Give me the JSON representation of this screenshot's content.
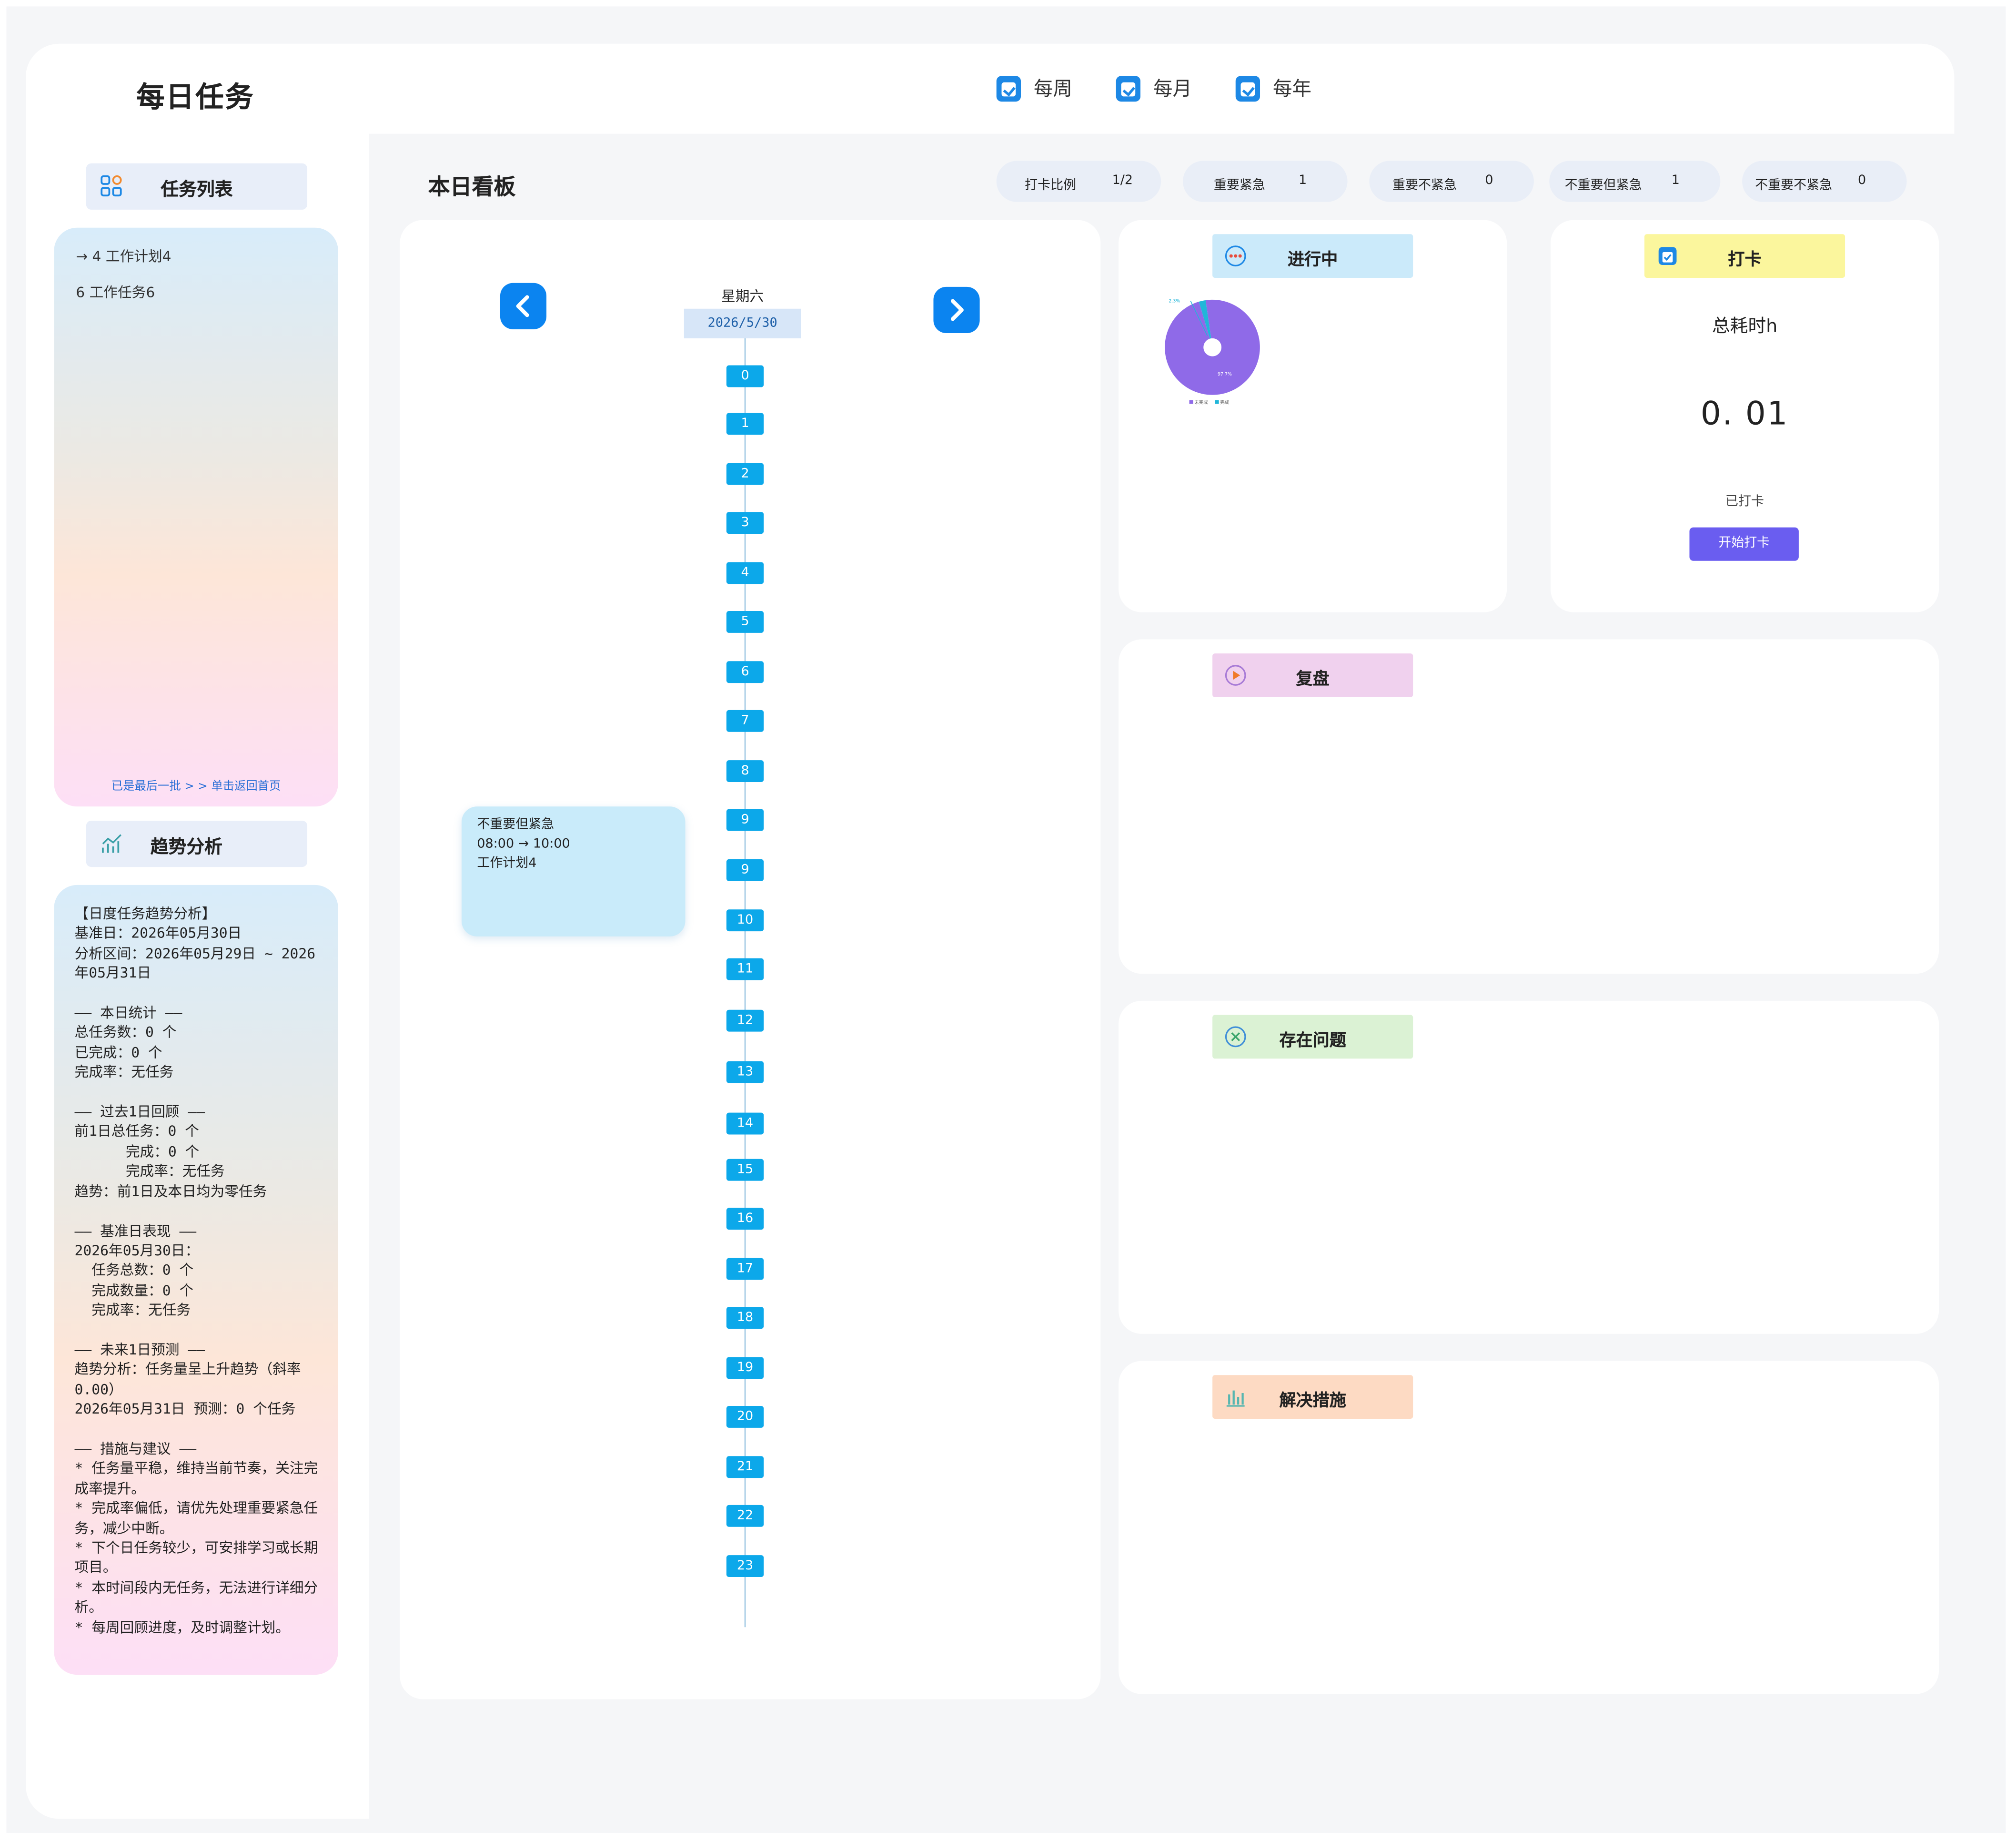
{
  "app": {
    "title": "每日任务"
  },
  "topnav": [
    {
      "label": "每周",
      "icon": "calendar-check-icon"
    },
    {
      "label": "每月",
      "icon": "calendar-check-icon"
    },
    {
      "label": "每年",
      "icon": "calendar-check-icon"
    }
  ],
  "sidebar": {
    "task_list_label": "任务列表",
    "tasks": [
      "→ 4 工作计划4",
      "6 工作任务6"
    ],
    "end_hint": "已是最后一批 > > 单击返回首页",
    "trend_label": "趋势分析",
    "trend_text": "【日度任务趋势分析】\n基准日：2026年05月30日\n分析区间：2026年05月29日 ~ 2026年05月31日\n\n—— 本日统计 ——\n总任务数：0 个\n已完成：0 个\n完成率：无任务\n\n—— 过去1日回顾 ——\n前1日总任务：0 个\n      完成：0 个\n      完成率：无任务\n趋势：前1日及本日均为零任务\n\n—— 基准日表现 ——\n2026年05月30日：\n  任务总数：0 个\n  完成数量：0 个\n  完成率：无任务\n\n—— 未来1日预测 ——\n趋势分析：任务量呈上升趋势（斜率0.00）\n2026年05月31日 预测：0 个任务\n\n—— 措施与建议 ——\n* 任务量平稳，维持当前节奏，关注完成率提升。\n* 完成率偏低，请优先处理重要紧急任务，减少中断。\n* 下个日任务较少，可安排学习或长期项目。\n* 本时间段内无任务，无法进行详细分析。\n* 每周回顾进度，及时调整计划。"
  },
  "board": {
    "title": "本日看板",
    "stats": [
      {
        "label": "打卡比例",
        "value": "1/2"
      },
      {
        "label": "重要紧急",
        "value": "1"
      },
      {
        "label": "重要不紧急",
        "value": "0"
      },
      {
        "label": "不重要但紧急",
        "value": "1"
      },
      {
        "label": "不重要不紧急",
        "value": "0"
      }
    ]
  },
  "timeline": {
    "weekday": "星期六",
    "date": "2026/5/30",
    "hours": [
      "0",
      "1",
      "2",
      "3",
      "4",
      "5",
      "6",
      "7",
      "8",
      "9",
      "9",
      "10",
      "11",
      "12",
      "13",
      "14",
      "15",
      "16",
      "17",
      "18",
      "19",
      "20",
      "21",
      "22",
      "23"
    ],
    "event": {
      "category": "不重要但紧急",
      "time": "08:00 → 10:00",
      "name": "工作计划4"
    }
  },
  "progress": {
    "title": "进行中",
    "icon": "more-dots-icon",
    "chart_data": {
      "type": "pie",
      "slices": [
        {
          "label": "未完成",
          "value": 97.7,
          "color": "#8f6ae8"
        },
        {
          "label": "完成",
          "value": 2.3,
          "color": "#21b6d9"
        }
      ],
      "callout_small": "2.3%",
      "callout_large": "97.7%",
      "legend": [
        "未完成",
        "完成"
      ]
    }
  },
  "checkin": {
    "title": "打卡",
    "icon": "calendar-check-icon",
    "total_label": "总耗时h",
    "total_value": "0. 01",
    "status": "已打卡",
    "button_label": "开始打卡"
  },
  "review": {
    "title": "复盘",
    "icon": "play-circle-icon",
    "color": "#f0d1ee"
  },
  "issues": {
    "title": "存在问题",
    "icon": "close-circle-icon",
    "color": "#dbf2d4"
  },
  "solutions": {
    "title": "解决措施",
    "icon": "bar-chart-icon",
    "color": "#fddac3"
  }
}
